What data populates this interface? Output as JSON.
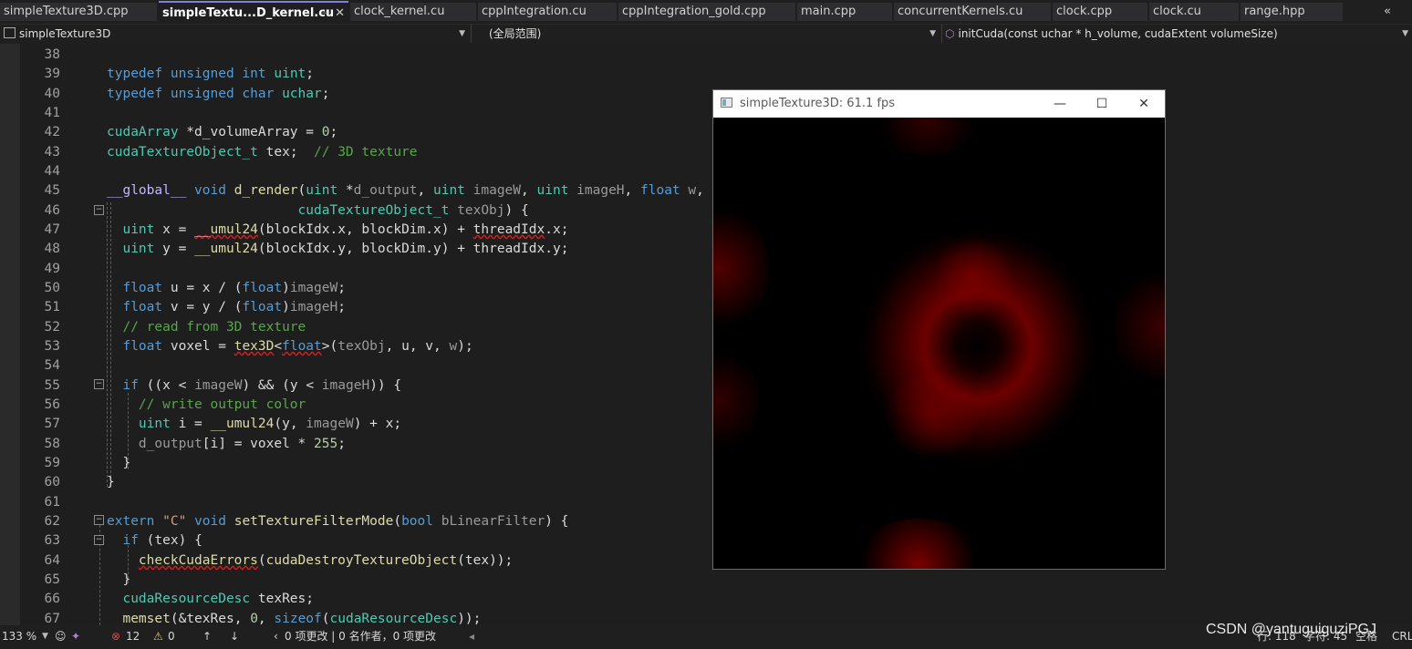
{
  "tabs": [
    {
      "label": "simpleTexture3D.cpp"
    },
    {
      "label": "simpleTextu...D_kernel.cu",
      "active": true
    },
    {
      "label": "clock_kernel.cu"
    },
    {
      "label": "cppIntegration.cu"
    },
    {
      "label": "cppIntegration_gold.cpp"
    },
    {
      "label": "main.cpp"
    },
    {
      "label": "concurrentKernels.cu"
    },
    {
      "label": "clock.cpp"
    },
    {
      "label": "clock.cu"
    },
    {
      "label": "range.hpp"
    }
  ],
  "tab_icons": {
    "pin": "pin-icon",
    "close": "close-icon",
    "overflow": "chevron-double-left-icon"
  },
  "navbar": {
    "project": "simpleTexture3D",
    "scope": "(全局范围)",
    "function": "initCuda(const uchar * h_volume, cudaExtent volumeSize)"
  },
  "code": {
    "line_numbers": [
      "38",
      "39",
      "40",
      "41",
      "42",
      "43",
      "44",
      "45",
      "46",
      "47",
      "48",
      "49",
      "50",
      "51",
      "52",
      "53",
      "54",
      "55",
      "56",
      "57",
      "58",
      "59",
      "60",
      "61",
      "62",
      "63",
      "64",
      "65",
      "66",
      "67"
    ]
  },
  "window": {
    "title": "simpleTexture3D: 61.1 fps",
    "minimize": "—",
    "maximize": "☐",
    "close": "✕"
  },
  "status": {
    "zoom": "133 %",
    "errors": "12",
    "warnings": "0",
    "changes": "0 项更改 | 0 名作者，0 项更改",
    "line_label": "行: 118",
    "char_label": "字符: 45",
    "spacing": "空格",
    "eol": "CRLF"
  },
  "watermark": "CSDN @yantuguiguziPGJ",
  "colors": {
    "accent": "#7f7fdf",
    "keyword": "#569cd6",
    "type": "#4ec9b0",
    "comment": "#57a64a",
    "function": "#dcdcaa",
    "volume_red": "#8b0000"
  }
}
